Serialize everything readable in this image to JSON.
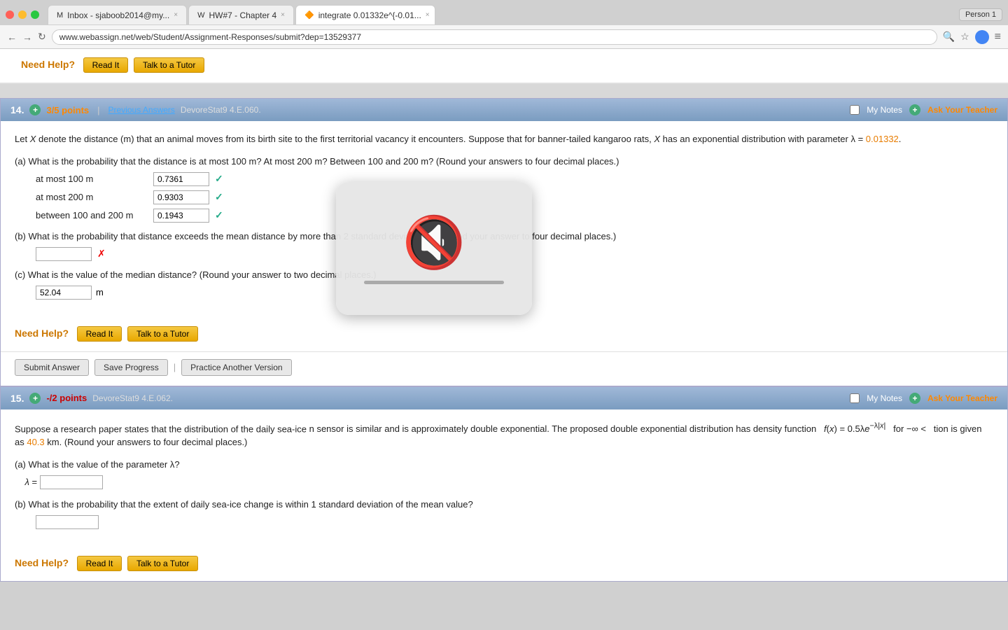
{
  "browser": {
    "tabs": [
      {
        "label": "Inbox - sjaboob2014@my...",
        "favicon": "M",
        "active": false
      },
      {
        "label": "HW#7 - Chapter 4",
        "favicon": "W",
        "active": false
      },
      {
        "label": "integrate 0.01332e^{-0.01...",
        "favicon": "🔶",
        "active": true
      }
    ],
    "url": "www.webassign.net/web/Student/Assignment-Responses/submit?dep=13529377",
    "person": "Person 1"
  },
  "top_need_help": {
    "label": "Need Help?",
    "read_it": "Read It",
    "talk_tutor": "Talk to a Tutor"
  },
  "q14": {
    "number": "14.",
    "points": "3/5 points",
    "pipe": "|",
    "prev_answers": "Previous Answers",
    "source": "DevoreStat9 4.E.060.",
    "my_notes": "My Notes",
    "ask_teacher": "Ask Your Teacher",
    "body_text": "Let X denote the distance (m) that an animal moves from its birth site to the first territorial vacancy it encounters. Suppose that for banner-tailed kangaroo rats, X has an exponential distribution with parameter λ =",
    "lambda_val": "0.01332",
    "body_text2": ".",
    "part_a_text": "(a) What is the probability that the distance is at most 100 m? At most 200 m? Between 100 and 200 m? (Round your answers to four decimal places.)",
    "rows": [
      {
        "label": "at most 100 m",
        "value": "0.7361",
        "check": "✓"
      },
      {
        "label": "at most 200 m",
        "value": "0.9303",
        "check": "✓"
      },
      {
        "label": "between 100 and 200 m",
        "value": "0.1943",
        "check": "✓"
      }
    ],
    "part_b_text": "(b) What is the probability that distance exceeds the mean distance by more than 2 standard deviations? (Round your answer to four decimal places.)",
    "part_b_value": "",
    "part_b_check": "✗",
    "part_c_text": "(c) What is the value of the median distance? (Round your answer to two decimal places.)",
    "part_c_value": "52.04",
    "part_c_unit": "m",
    "need_help_label": "Need Help?",
    "read_it": "Read It",
    "talk_tutor": "Talk to a Tutor",
    "submit_btn": "Submit Answer",
    "save_btn": "Save Progress",
    "practice_btn": "Practice Another Version"
  },
  "q15": {
    "number": "15.",
    "points": "-/2 points",
    "source": "DevoreStat9 4.E.062.",
    "my_notes": "My Notes",
    "ask_teacher": "Ask Your Teacher",
    "body_text": "Suppose a research paper states that the distribution of the daily sea-ice",
    "body_text2": "n sensor is similar and is approximately double exponential. The proposed double exponential distribution has density function",
    "density_text": "f(x) = 0.5λe",
    "density_exp": "−λ|x|",
    "density_range": "for −∞ <",
    "density_end": "tion is given as",
    "orange_val": "40.3",
    "body_end": "km. (Round your answers to four decimal places.)",
    "part_a_text": "(a) What is the value of the parameter λ?",
    "lambda_label": "λ =",
    "lambda_value": "",
    "part_b_text": "(b) What is the probability that the extent of daily sea-ice change is within 1 standard deviation of the mean value?",
    "part_b_value": "",
    "need_help_label": "Need Help?",
    "read_it": "Read It",
    "talk_tutor": "Talk to a Tutor"
  },
  "mute": {
    "visible": true
  },
  "icons": {
    "mute": "🔇",
    "check": "✓",
    "cross": "✗"
  }
}
